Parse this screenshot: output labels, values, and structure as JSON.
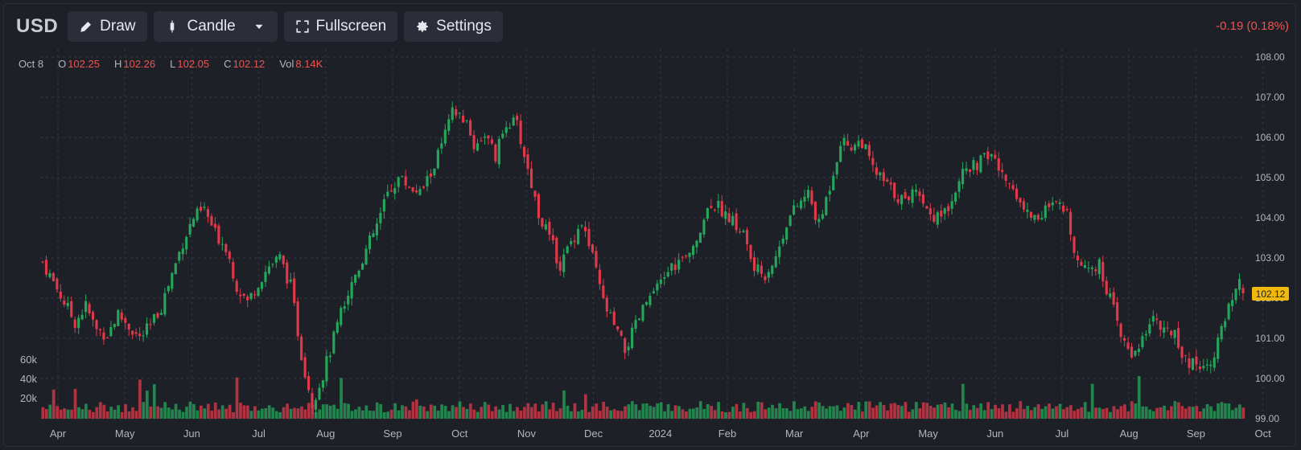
{
  "toolbar": {
    "symbol": "USD",
    "draw_label": "Draw",
    "chart_type_label": "Candle",
    "fullscreen_label": "Fullscreen",
    "settings_label": "Settings"
  },
  "change_text": "-0.19 (0.18%)",
  "ohlc": {
    "date": "Oct 8",
    "o_label": "O",
    "o_value": "102.25",
    "h_label": "H",
    "h_value": "102.26",
    "l_label": "L",
    "l_value": "102.05",
    "c_label": "C",
    "c_value": "102.12",
    "vol_label": "Vol",
    "vol_value": "8.14K"
  },
  "last_price_tag": "102.12",
  "colors": {
    "up": "#26a65b",
    "down": "#e0394a",
    "background": "#1e2028",
    "grid": "#343843",
    "price_tag": "#f0b90b"
  },
  "chart_data": {
    "type": "candlestick",
    "price_axis": {
      "min": 99.0,
      "max": 108.0,
      "ticks": [
        "108.00",
        "107.00",
        "106.00",
        "105.00",
        "104.00",
        "103.00",
        "102.00",
        "101.00",
        "100.00",
        "99.00"
      ]
    },
    "volume_axis": {
      "ticks": [
        "60k",
        "40k",
        "20k"
      ]
    },
    "x_labels": [
      "Apr",
      "May",
      "Jun",
      "Jul",
      "Aug",
      "Sep",
      "Oct",
      "Nov",
      "Dec",
      "2024",
      "Feb",
      "Mar",
      "Apr",
      "May",
      "Jun",
      "Jul",
      "Aug",
      "Sep",
      "Oct"
    ],
    "close_path": [
      [
        0,
        102.9
      ],
      [
        3,
        102.4
      ],
      [
        6,
        101.9
      ],
      [
        9,
        101.4
      ],
      [
        12,
        101.8
      ],
      [
        15,
        101.2
      ],
      [
        18,
        101.1
      ],
      [
        21,
        101.6
      ],
      [
        24,
        101.3
      ],
      [
        27,
        101.0
      ],
      [
        30,
        101.3
      ],
      [
        33,
        101.8
      ],
      [
        36,
        102.6
      ],
      [
        39,
        103.4
      ],
      [
        42,
        104.0
      ],
      [
        45,
        104.2
      ],
      [
        48,
        103.6
      ],
      [
        51,
        103.3
      ],
      [
        54,
        102.3
      ],
      [
        57,
        101.9
      ],
      [
        60,
        102.4
      ],
      [
        63,
        102.8
      ],
      [
        66,
        103.0
      ],
      [
        69,
        102.3
      ],
      [
        72,
        100.6
      ],
      [
        75,
        99.4
      ],
      [
        78,
        100.1
      ],
      [
        81,
        101.0
      ],
      [
        84,
        101.9
      ],
      [
        87,
        102.6
      ],
      [
        90,
        103.2
      ],
      [
        93,
        103.8
      ],
      [
        96,
        104.6
      ],
      [
        99,
        105.0
      ],
      [
        102,
        104.8
      ],
      [
        105,
        104.6
      ],
      [
        108,
        105.1
      ],
      [
        111,
        105.8
      ],
      [
        114,
        106.6
      ],
      [
        117,
        106.5
      ],
      [
        120,
        105.8
      ],
      [
        123,
        106.1
      ],
      [
        126,
        105.5
      ],
      [
        129,
        106.4
      ],
      [
        132,
        106.3
      ],
      [
        135,
        105.2
      ],
      [
        138,
        104.1
      ],
      [
        141,
        103.5
      ],
      [
        144,
        102.8
      ],
      [
        147,
        103.4
      ],
      [
        150,
        103.9
      ],
      [
        153,
        103.0
      ],
      [
        156,
        101.9
      ],
      [
        159,
        101.3
      ],
      [
        162,
        100.7
      ],
      [
        165,
        101.3
      ],
      [
        168,
        101.9
      ],
      [
        171,
        102.2
      ],
      [
        174,
        102.7
      ],
      [
        177,
        102.9
      ],
      [
        180,
        103.0
      ],
      [
        183,
        103.8
      ],
      [
        186,
        104.4
      ],
      [
        189,
        104.2
      ],
      [
        192,
        103.9
      ],
      [
        195,
        103.6
      ],
      [
        198,
        102.7
      ],
      [
        201,
        102.6
      ],
      [
        204,
        103.0
      ],
      [
        207,
        103.9
      ],
      [
        210,
        104.3
      ],
      [
        213,
        104.6
      ],
      [
        216,
        103.8
      ],
      [
        219,
        104.8
      ],
      [
        222,
        105.9
      ],
      [
        225,
        105.8
      ],
      [
        228,
        105.9
      ],
      [
        231,
        105.2
      ],
      [
        234,
        104.9
      ],
      [
        237,
        104.6
      ],
      [
        240,
        104.4
      ],
      [
        243,
        104.8
      ],
      [
        246,
        104.2
      ],
      [
        249,
        104.0
      ],
      [
        252,
        104.3
      ],
      [
        255,
        105.0
      ],
      [
        258,
        105.2
      ],
      [
        261,
        105.4
      ],
      [
        264,
        105.6
      ],
      [
        267,
        105.0
      ],
      [
        270,
        104.8
      ],
      [
        273,
        104.2
      ],
      [
        276,
        104.0
      ],
      [
        279,
        104.2
      ],
      [
        282,
        104.3
      ],
      [
        285,
        104.1
      ],
      [
        288,
        102.9
      ],
      [
        291,
        102.8
      ],
      [
        294,
        102.8
      ],
      [
        297,
        102.0
      ],
      [
        300,
        101.0
      ],
      [
        303,
        100.6
      ],
      [
        306,
        101.0
      ],
      [
        309,
        101.6
      ],
      [
        312,
        101.1
      ],
      [
        315,
        101.2
      ],
      [
        318,
        100.4
      ],
      [
        321,
        100.4
      ],
      [
        324,
        100.3
      ],
      [
        327,
        100.9
      ],
      [
        330,
        101.7
      ],
      [
        333,
        102.3
      ],
      [
        334,
        102.12
      ]
    ],
    "last_bar": {
      "date": "Oct 8",
      "open": 102.25,
      "high": 102.26,
      "low": 102.05,
      "close": 102.12,
      "volume": "8.14K"
    }
  }
}
